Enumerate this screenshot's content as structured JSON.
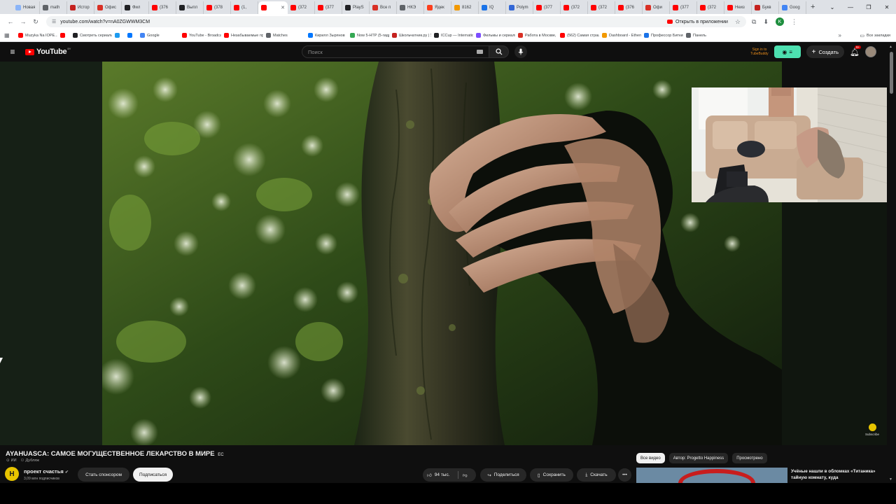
{
  "browser": {
    "tabs": [
      {
        "label": "Новая",
        "color": "#8ab4f8"
      },
      {
        "label": "math",
        "color": "#5f6368"
      },
      {
        "label": "Истор",
        "color": "#c5221f"
      },
      {
        "label": "Офис",
        "color": "#d93025"
      },
      {
        "label": "Фил",
        "color": "#202124"
      },
      {
        "label": "(376",
        "color": "#ff0000"
      },
      {
        "label": "Выпл",
        "color": "#202124"
      },
      {
        "label": "(378",
        "color": "#ff0000"
      },
      {
        "label": "(1,",
        "color": "#ff0000"
      },
      {
        "label": "",
        "color": "#ff0000",
        "active": true
      },
      {
        "label": "(372",
        "color": "#ff0000"
      },
      {
        "label": "(377",
        "color": "#ff0000"
      },
      {
        "label": "PlayS",
        "color": "#202124"
      },
      {
        "label": "Все п",
        "color": "#d93025"
      },
      {
        "label": "НКЭ",
        "color": "#5f6368"
      },
      {
        "label": "Ядек",
        "color": "#fc3f1d"
      },
      {
        "label": "8162",
        "color": "#f29900"
      },
      {
        "label": "IQ",
        "color": "#1a73e8"
      },
      {
        "label": "Polym",
        "color": "#3367d6"
      },
      {
        "label": "(377",
        "color": "#ff0000"
      },
      {
        "label": "(372",
        "color": "#ff0000"
      },
      {
        "label": "(372",
        "color": "#ff0000"
      },
      {
        "label": "(376",
        "color": "#ff0000"
      },
      {
        "label": "Офи",
        "color": "#d93025"
      },
      {
        "label": "(377",
        "color": "#ff0000"
      },
      {
        "label": "(372",
        "color": "#ff0000"
      },
      {
        "label": "Неиз",
        "color": "#ff0000"
      },
      {
        "label": "Букв",
        "color": "#c5221f"
      },
      {
        "label": "Goog",
        "color": "#4285f4"
      }
    ],
    "new_tab_label": "+",
    "url": "youtube.com/watch?v=nA0ZGWWM3CM",
    "open_in_app_label": "Открыть в приложении",
    "profile_letter": "K",
    "bookmarks": [
      {
        "label": "Muzyka Na IOPE...",
        "color": "#ff0000"
      },
      {
        "label": "",
        "color": "#ff0000"
      },
      {
        "label": "Смотреть сериалы...",
        "color": "#202124"
      },
      {
        "label": "",
        "color": "#1d9bf0"
      },
      {
        "label": "",
        "color": "#0077ff"
      },
      {
        "label": "Google",
        "color": "#4285f4"
      },
      {
        "label": "YouTube - Broadcas...",
        "color": "#ff0000"
      },
      {
        "label": "Незабываемые прох...",
        "color": "#ff0000"
      },
      {
        "label": "Matches",
        "color": "#5f6368"
      },
      {
        "label": "Кирилл Зырянов",
        "color": "#0077ff"
      },
      {
        "label": "Now 5-HTP (5-гидр...",
        "color": "#34a853"
      },
      {
        "label": "Школьчатник.ру | Уг...",
        "color": "#c5221f"
      },
      {
        "label": "ICCup — Internation...",
        "color": "#202124"
      },
      {
        "label": "Фильмы и сериалы...",
        "color": "#7c4dff"
      },
      {
        "label": "Работа в Москве, п...",
        "color": "#d93025"
      },
      {
        "label": "(562) Самая страшн...",
        "color": "#ff0000"
      },
      {
        "label": "Dashboard - Etherm...",
        "color": "#f29900"
      },
      {
        "label": "Профессор Биткин...",
        "color": "#1a73e8"
      },
      {
        "label": "Панель",
        "color": "#5f6368"
      }
    ],
    "all_bookmarks_label": "Все закладки"
  },
  "youtube": {
    "logo_text": "YouTube",
    "logo_region": "BY",
    "search_placeholder": "Поиск",
    "tubebuddy_line1": "Sign in to",
    "tubebuddy_line2": "TubeBuddy",
    "create_label": "Создать",
    "notifications_badge": "9+",
    "subscribe_watermark": "Subscribe"
  },
  "video": {
    "title": "AYAHUASCA: САМОЕ МОГУЩЕСТВЕННОЕ ЛЕКАРСТВО В МИРЕ",
    "title_suffix": "ЕС",
    "tag_ai": "ИИ",
    "tag_dub": "Дубляж",
    "channel_name": "проект счастья",
    "channel_initial": "H",
    "channel_subscribers": "3,09 млн подписчиков",
    "sponsor_label": "Стать спонсором",
    "subscribe_label": "Подписаться",
    "likes": "94 тыс.",
    "share_label": "Поделиться",
    "save_label": "Сохранить",
    "download_label": "Скачать",
    "more_label": "•••"
  },
  "recommendations": {
    "chips": [
      {
        "label": "Все видео",
        "active": true
      },
      {
        "label": "Автор: Progetto Happiness",
        "active": false
      },
      {
        "label": "Просмотрено",
        "active": false
      }
    ],
    "first_title": "Учёные нашли в обломках «Титаника» тайную комнату, куда"
  }
}
